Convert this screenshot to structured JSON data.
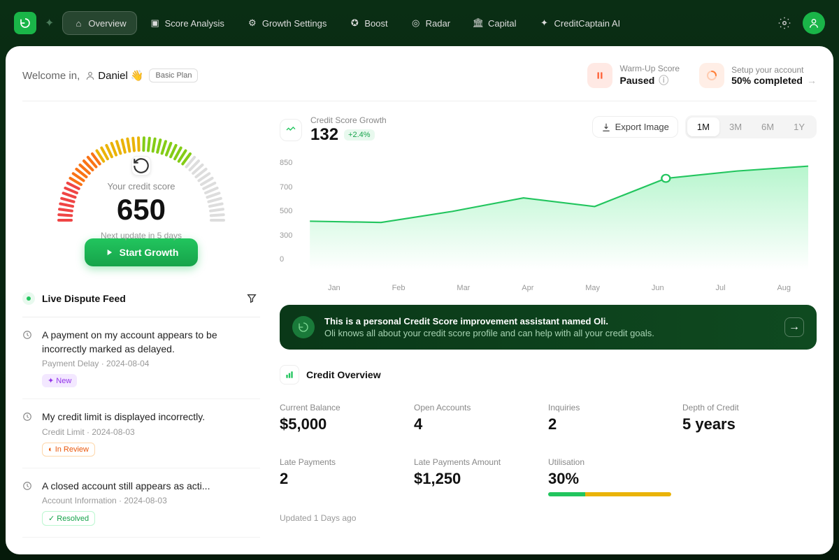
{
  "nav": {
    "items": [
      {
        "label": "Overview",
        "active": true
      },
      {
        "label": "Score Analysis"
      },
      {
        "label": "Growth Settings"
      },
      {
        "label": "Boost"
      },
      {
        "label": "Radar"
      },
      {
        "label": "Capital"
      },
      {
        "label": "CreditCaptain AI"
      }
    ]
  },
  "header": {
    "welcome_prefix": "Welcome in,",
    "user_name": "Daniel",
    "plan": "Basic Plan",
    "warm_up": {
      "label": "Warm-Up Score",
      "value": "Paused"
    },
    "setup": {
      "label": "Setup your account",
      "value": "50% completed"
    }
  },
  "gauge": {
    "label": "Your credit score",
    "score": "650",
    "update_text": "Next update in 5 days",
    "button": "Start Growth"
  },
  "feed": {
    "title": "Live Dispute Feed",
    "items": [
      {
        "title": "A payment on my account appears to be incorrectly marked as delayed.",
        "category": "Payment Delay",
        "date": "2024-08-04",
        "status": "New",
        "status_class": "new"
      },
      {
        "title": "My credit limit is displayed incorrectly.",
        "category": "Credit Limit",
        "date": "2024-08-03",
        "status": "In Review",
        "status_class": "review"
      },
      {
        "title": "A closed account still appears as acti...",
        "category": "Account Information",
        "date": "2024-08-03",
        "status": "Resolved",
        "status_class": "resolved"
      }
    ]
  },
  "growth": {
    "label": "Credit Score Growth",
    "value": "132",
    "delta": "+2.4%",
    "export": "Export Image",
    "tabs": [
      "1M",
      "3M",
      "6M",
      "1Y"
    ],
    "active_tab": "1M"
  },
  "chart_data": {
    "type": "line",
    "categories": [
      "Jan",
      "Feb",
      "Mar",
      "Apr",
      "May",
      "Jun",
      "Jul",
      "Aug"
    ],
    "values": [
      400,
      390,
      480,
      590,
      520,
      750,
      810,
      850
    ],
    "y_ticks": [
      "850",
      "700",
      "500",
      "300",
      "0"
    ],
    "ylim": [
      0,
      850
    ],
    "xlabel": "",
    "ylabel": "",
    "title": "Credit Score Growth"
  },
  "oli": {
    "title": "This is a personal Credit Score improvement assistant named Oli.",
    "sub": "Oli knows all about your credit score profile and can help with all your credit goals."
  },
  "overview": {
    "title": "Credit Overview",
    "row1": [
      {
        "label": "Current Balance",
        "value": "$5,000"
      },
      {
        "label": "Open Accounts",
        "value": "4"
      },
      {
        "label": "Inquiries",
        "value": "2"
      },
      {
        "label": "Depth of Credit",
        "value": "5 years"
      }
    ],
    "row2": [
      {
        "label": "Late Payments",
        "value": "2"
      },
      {
        "label": "Late Payments Amount",
        "value": "$1,250"
      },
      {
        "label": "Utilisation",
        "value": "30%",
        "bar": true
      }
    ],
    "updated": "Updated 1 Days ago"
  }
}
